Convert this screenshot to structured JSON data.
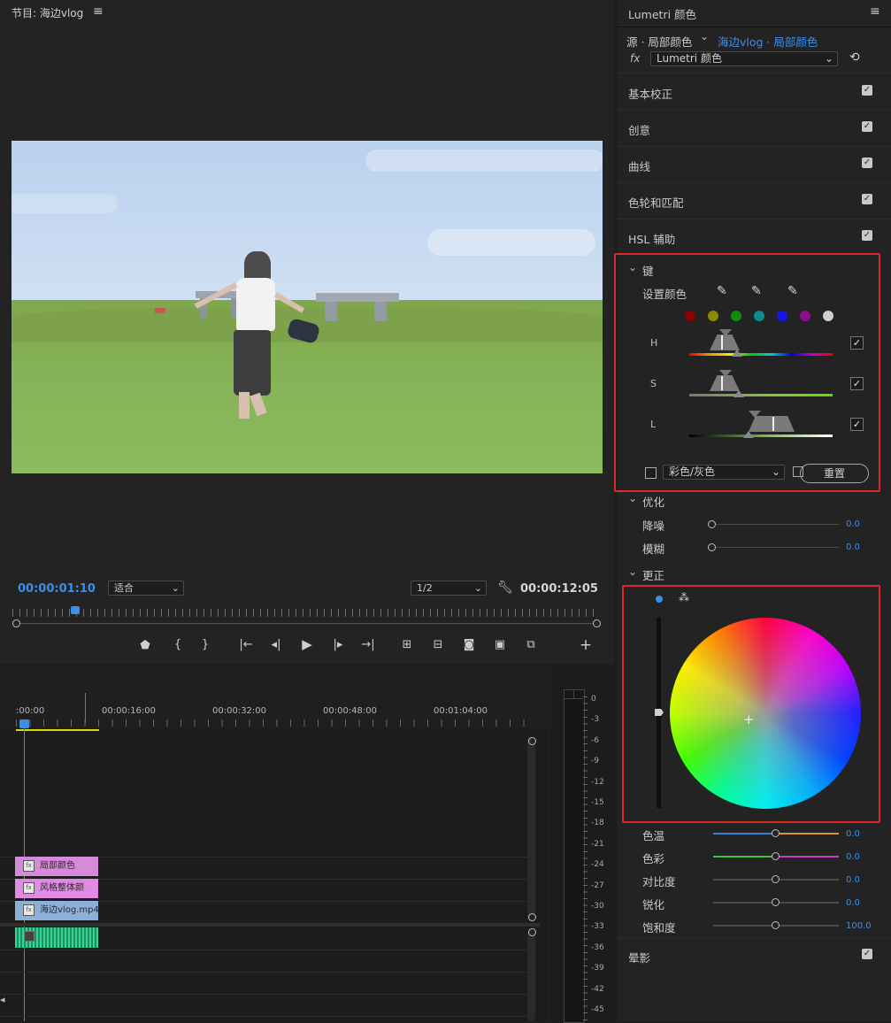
{
  "program": {
    "title": "节目: 海边vlog",
    "menu_icon": "hamburger-icon",
    "current_time": "00:00:01:10",
    "fit_value": "适合",
    "resolution_value": "1/2",
    "duration": "00:00:12:05"
  },
  "transport": {
    "icons": [
      "marker-icon",
      "mark-in-icon",
      "mark-out-icon",
      "go-to-in-icon",
      "step-back-icon",
      "play-icon",
      "step-forward-icon",
      "go-to-out-icon",
      "lift-icon",
      "extract-icon",
      "camera-icon",
      "compare-icon",
      "multicam-icon",
      "add-icon"
    ]
  },
  "timeline": {
    "ruler_labels": [
      ":00:00",
      "00:00:16:00",
      "00:00:32:00",
      "00:00:48:00",
      "00:01:04:00"
    ],
    "clips": [
      {
        "label": "局部颜色",
        "color": "#d68ad9"
      },
      {
        "label": "风格整体颜",
        "color": "#e08ae3"
      },
      {
        "label": "海边vlog.mp4",
        "color": "#8cb0dc"
      }
    ],
    "audio_color": "#2fbf86"
  },
  "meter": {
    "labels": [
      "0",
      "-3",
      "-6",
      "-9",
      "-12",
      "-15",
      "-18",
      "-21",
      "-24",
      "-27",
      "-30",
      "-33",
      "-36",
      "-39",
      "-42",
      "-45"
    ]
  },
  "lumetri": {
    "title": "Lumetri 颜色",
    "source_label": "源 · 局部颜色",
    "target_label": "海边vlog · 局部颜色",
    "fx_label": "fx",
    "effect_value": "Lumetri 颜色",
    "sections": [
      {
        "label": "基本校正",
        "checked": true
      },
      {
        "label": "创意",
        "checked": true
      },
      {
        "label": "曲线",
        "checked": true
      },
      {
        "label": "色轮和匹配",
        "checked": true
      },
      {
        "label": "HSL 辅助",
        "checked": true
      }
    ],
    "key": {
      "title": "键",
      "set_color_label": "设置颜色",
      "swatches": [
        "#8b0000",
        "#8b8b00",
        "#0e8a0e",
        "#0e8b8b",
        "#1515ee",
        "#8b0e8b",
        "#cfcfcf"
      ],
      "channels": [
        {
          "label": "H",
          "checked": true
        },
        {
          "label": "S",
          "checked": true
        },
        {
          "label": "L",
          "checked": true
        }
      ],
      "display_mode": "彩色/灰色",
      "reset_label": "重置"
    },
    "refine": {
      "title": "优化",
      "rows": [
        {
          "label": "降噪",
          "value": "0.0"
        },
        {
          "label": "模糊",
          "value": "0.0"
        }
      ]
    },
    "correction": {
      "title": "更正",
      "rows": [
        {
          "label": "色温",
          "value": "0.0",
          "level": 0.5
        },
        {
          "label": "色彩",
          "value": "0.0",
          "level": 0.5
        },
        {
          "label": "对比度",
          "value": "0.0",
          "level": 0.5
        },
        {
          "label": "锐化",
          "value": "0.0",
          "level": 0.5
        },
        {
          "label": "饱和度",
          "value": "100.0",
          "level": 0.5
        }
      ]
    },
    "vignette": {
      "label": "晕影",
      "checked": true
    }
  }
}
